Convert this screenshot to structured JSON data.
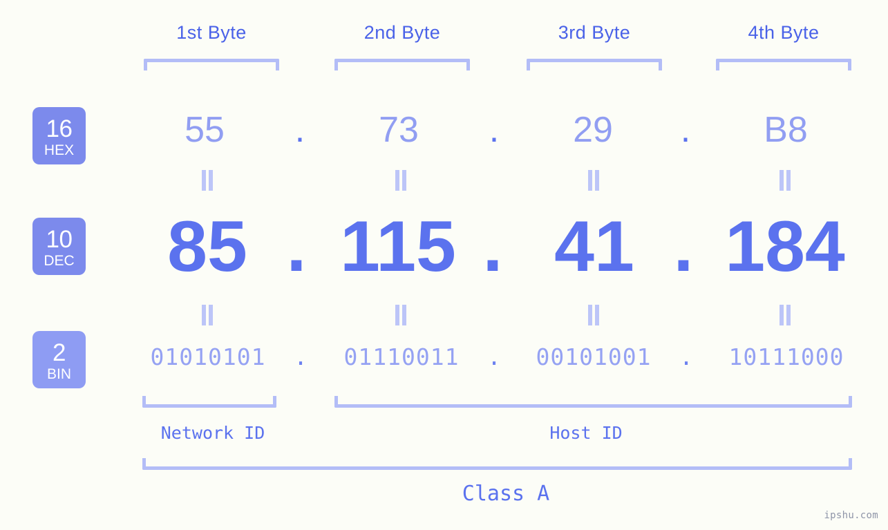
{
  "watermark": "ipshu.com",
  "byte_headers": [
    {
      "label": "1st Byte"
    },
    {
      "label": "2nd Byte"
    },
    {
      "label": "3rd Byte"
    },
    {
      "label": "4th Byte"
    }
  ],
  "bases": [
    {
      "number": "16",
      "name": "HEX",
      "color": "#7c8aec"
    },
    {
      "number": "10",
      "name": "DEC",
      "color": "#7c8aec"
    },
    {
      "number": "2",
      "name": "BIN",
      "color": "#8e9cf3"
    }
  ],
  "rows": {
    "hex": {
      "values": [
        "55",
        "73",
        "29",
        "B8"
      ],
      "separator": ".",
      "color": "#919ef2"
    },
    "dec": {
      "values": [
        "85",
        "115",
        "41",
        "184"
      ],
      "separator": ".",
      "color": "#5b72ee"
    },
    "bin": {
      "values": [
        "01010101",
        "01110011",
        "00101001",
        "10111000"
      ],
      "separator": ".",
      "color": "#95a2f3"
    }
  },
  "equals_symbol": "=",
  "segments": {
    "network_id": "Network ID",
    "host_id": "Host ID",
    "class": "Class A"
  },
  "accent": {
    "header_text": "#4a62e8",
    "bracket": "#b3bdf7",
    "background": "#fcfdf7"
  }
}
